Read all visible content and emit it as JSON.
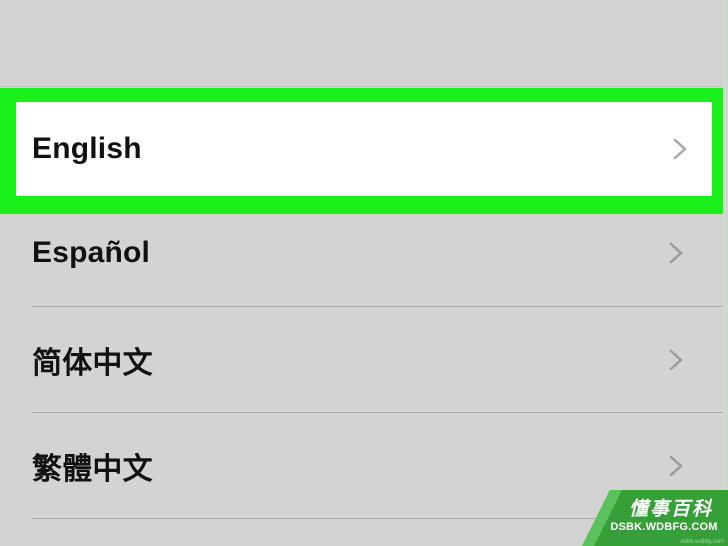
{
  "languages": [
    {
      "label": "English",
      "selected": true
    },
    {
      "label": "Español",
      "selected": false
    },
    {
      "label": "简体中文",
      "selected": false
    },
    {
      "label": "繁體中文",
      "selected": false
    }
  ],
  "watermark": {
    "title": "懂事百科",
    "subtitle": "DSBK.WDBFG.COM",
    "tiny": "dsbk.wdbfg.com"
  },
  "colors": {
    "background": "#d3d3d3",
    "highlight": "#19f019",
    "selected_row": "#ffffff",
    "text": "#111111",
    "chevron": "#9a9a9a",
    "watermark_green": "#2e9c2e"
  },
  "icons": {
    "row_chevron": "chevron-right-icon"
  }
}
